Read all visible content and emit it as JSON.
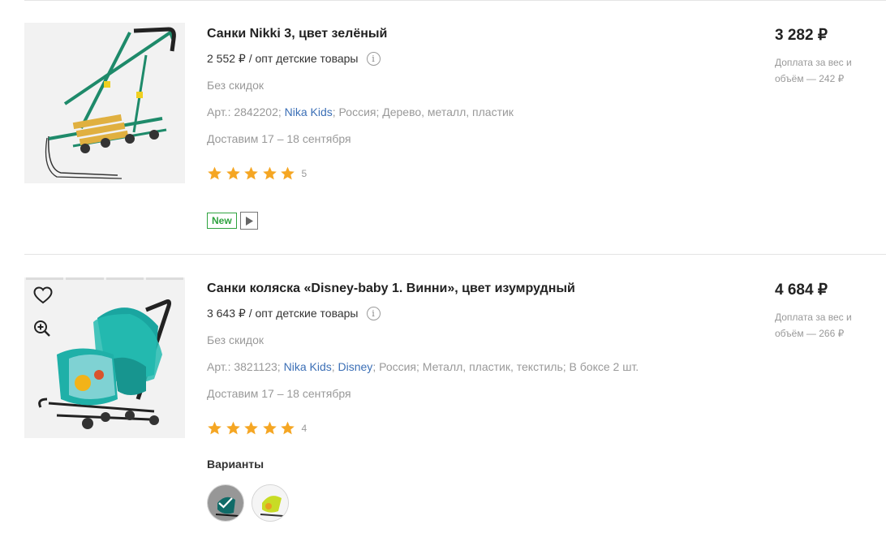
{
  "colors": {
    "accent_link": "#3b6fb6",
    "star": "#f5a623",
    "new_badge": "#2fa33f",
    "muted": "#999999"
  },
  "products": [
    {
      "title": "Санки Nikki 3, цвет зелёный",
      "opt_price": "2 552 ₽ / опт детские товары",
      "discount": "Без скидок",
      "art_prefix": "Арт.: 2842202;",
      "brand": "Nika Kids",
      "attrs_suffix": "; Россия; Дерево, металл, пластик",
      "delivery": "Доставим 17 – 18 сентября",
      "rating": 5,
      "reviews": "5",
      "badge_new": "New",
      "price": "3 282 ₽",
      "surcharge": "Доплата за вес и объём — 242 ₽"
    },
    {
      "title": "Санки коляска «Disney-baby 1. Винни», цвет изумрудный",
      "opt_price": "3 643 ₽ / опт детские товары",
      "discount": "Без скидок",
      "art_prefix": "Арт.: 3821123;",
      "brand": "Nika Kids",
      "sep": ";",
      "brand2": "Disney",
      "attrs_suffix": "; Россия; Металл, пластик, текстиль; В боксе 2 шт.",
      "delivery": "Доставим 17 – 18 сентября",
      "rating": 5,
      "reviews": "4",
      "price": "4 684 ₽",
      "surcharge": "Доплата за вес и объём — 266 ₽",
      "variants_label": "Варианты",
      "icons": [
        "heart-icon",
        "zoom-in-icon",
        "checkmark-icon"
      ]
    }
  ]
}
